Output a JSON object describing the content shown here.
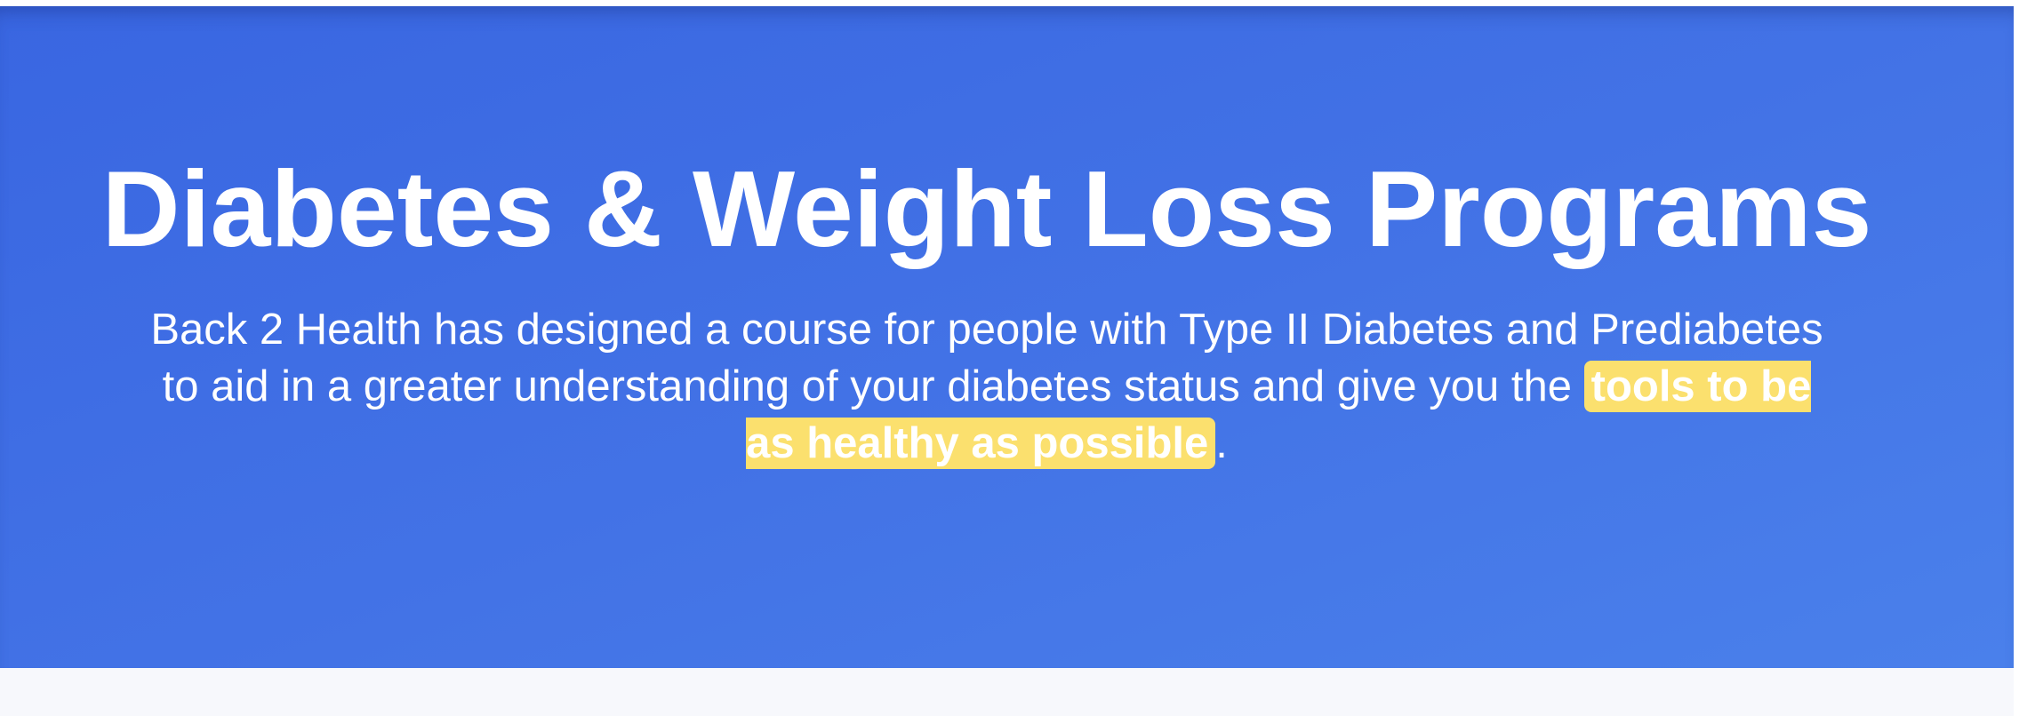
{
  "hero": {
    "title": "Diabetes & Weight Loss Programs",
    "description_before": "Back 2 Health has designed a course for people with Type II Diabetes and Prediabetes to aid in a greater understanding of your diabetes status and give you the ",
    "description_highlight": "tools to be as healthy as possible",
    "description_after": "."
  },
  "colors": {
    "hero_background": "#3f6de4",
    "highlight": "#fbe06e",
    "text": "#ffffff"
  }
}
